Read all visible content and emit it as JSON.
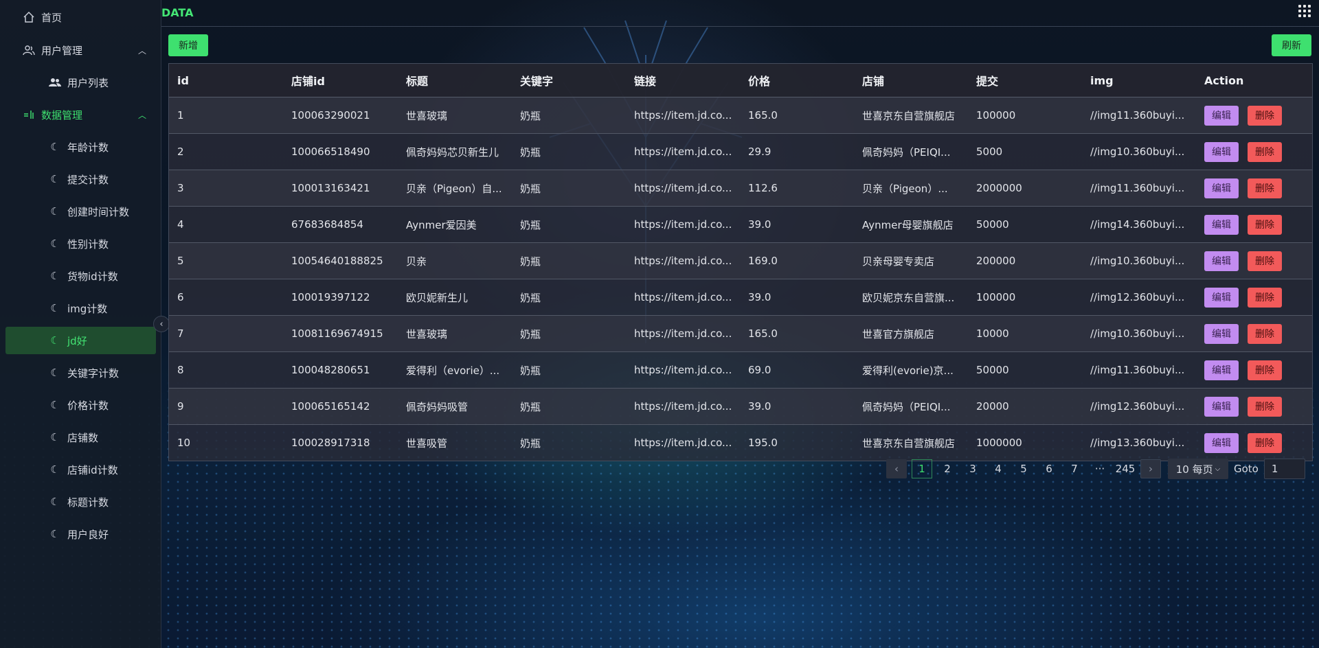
{
  "sidebar": {
    "home": "首页",
    "user_mgmt": "用户管理",
    "user_list": "用户列表",
    "data_mgmt": "数据管理",
    "items": [
      "年龄计数",
      "提交计数",
      "创建时间计数",
      "性别计数",
      "货物id计数",
      "img计数",
      "jd好",
      "关键字计数",
      "价格计数",
      "店铺数",
      "店铺id计数",
      "标题计数",
      "用户良好"
    ],
    "active_item": "jd好"
  },
  "header": {
    "brand": "DATA"
  },
  "toolbar": {
    "add_label": "新增",
    "refresh_label": "刷新"
  },
  "table": {
    "columns": [
      "id",
      "店铺id",
      "标题",
      "关键字",
      "链接",
      "价格",
      "店铺",
      "提交",
      "img",
      "Action"
    ],
    "rows": [
      [
        "1",
        "100063290021",
        "世喜玻璃",
        "奶瓶",
        "https://item.jd.co...",
        "165.0",
        "世喜京东自营旗舰店",
        "100000",
        "//img11.360buyi..."
      ],
      [
        "2",
        "100066518490",
        "佩奇妈妈芯贝新生儿",
        "奶瓶",
        "https://item.jd.co...",
        "29.9",
        "佩奇妈妈（PEIQI...",
        "5000",
        "//img10.360buyi..."
      ],
      [
        "3",
        "100013163421",
        "贝亲（Pigeon）自...",
        "奶瓶",
        "https://item.jd.co...",
        "112.6",
        "贝亲（Pigeon）...",
        "2000000",
        "//img11.360buyi..."
      ],
      [
        "4",
        "67683684854",
        "Aynmer爱因美",
        "奶瓶",
        "https://item.jd.co...",
        "39.0",
        "Aynmer母婴旗舰店",
        "50000",
        "//img14.360buyi..."
      ],
      [
        "5",
        "10054640188825",
        "贝亲",
        "奶瓶",
        "https://item.jd.co...",
        "169.0",
        "贝亲母婴专卖店",
        "200000",
        "//img10.360buyi..."
      ],
      [
        "6",
        "100019397122",
        "欧贝妮新生儿",
        "奶瓶",
        "https://item.jd.co...",
        "39.0",
        "欧贝妮京东自营旗...",
        "100000",
        "//img12.360buyi..."
      ],
      [
        "7",
        "10081169674915",
        "世喜玻璃",
        "奶瓶",
        "https://item.jd.co...",
        "165.0",
        "世喜官方旗舰店",
        "10000",
        "//img10.360buyi..."
      ],
      [
        "8",
        "100048280651",
        "爱得利（evorie）...",
        "奶瓶",
        "https://item.jd.co...",
        "69.0",
        "爱得利(evorie)京...",
        "50000",
        "//img11.360buyi..."
      ],
      [
        "9",
        "100065165142",
        "佩奇妈妈吸管",
        "奶瓶",
        "https://item.jd.co...",
        "39.0",
        "佩奇妈妈（PEIQI...",
        "20000",
        "//img12.360buyi..."
      ],
      [
        "10",
        "100028917318",
        "世喜吸管",
        "奶瓶",
        "https://item.jd.co...",
        "195.0",
        "世喜京东自营旗舰店",
        "1000000",
        "//img13.360buyi..."
      ]
    ],
    "edit_label": "编辑",
    "delete_label": "删除"
  },
  "pagination": {
    "prev": "‹",
    "pages": [
      "1",
      "2",
      "3",
      "4",
      "5",
      "6",
      "7"
    ],
    "ellipsis": "···",
    "last": "245",
    "next": "›",
    "current": "1",
    "page_size": "10 每页",
    "goto_label": "Goto",
    "goto_value": "1"
  },
  "colors": {
    "accent": "#3ee06f",
    "edit": "#c28cf0",
    "delete": "#f25a5a"
  }
}
